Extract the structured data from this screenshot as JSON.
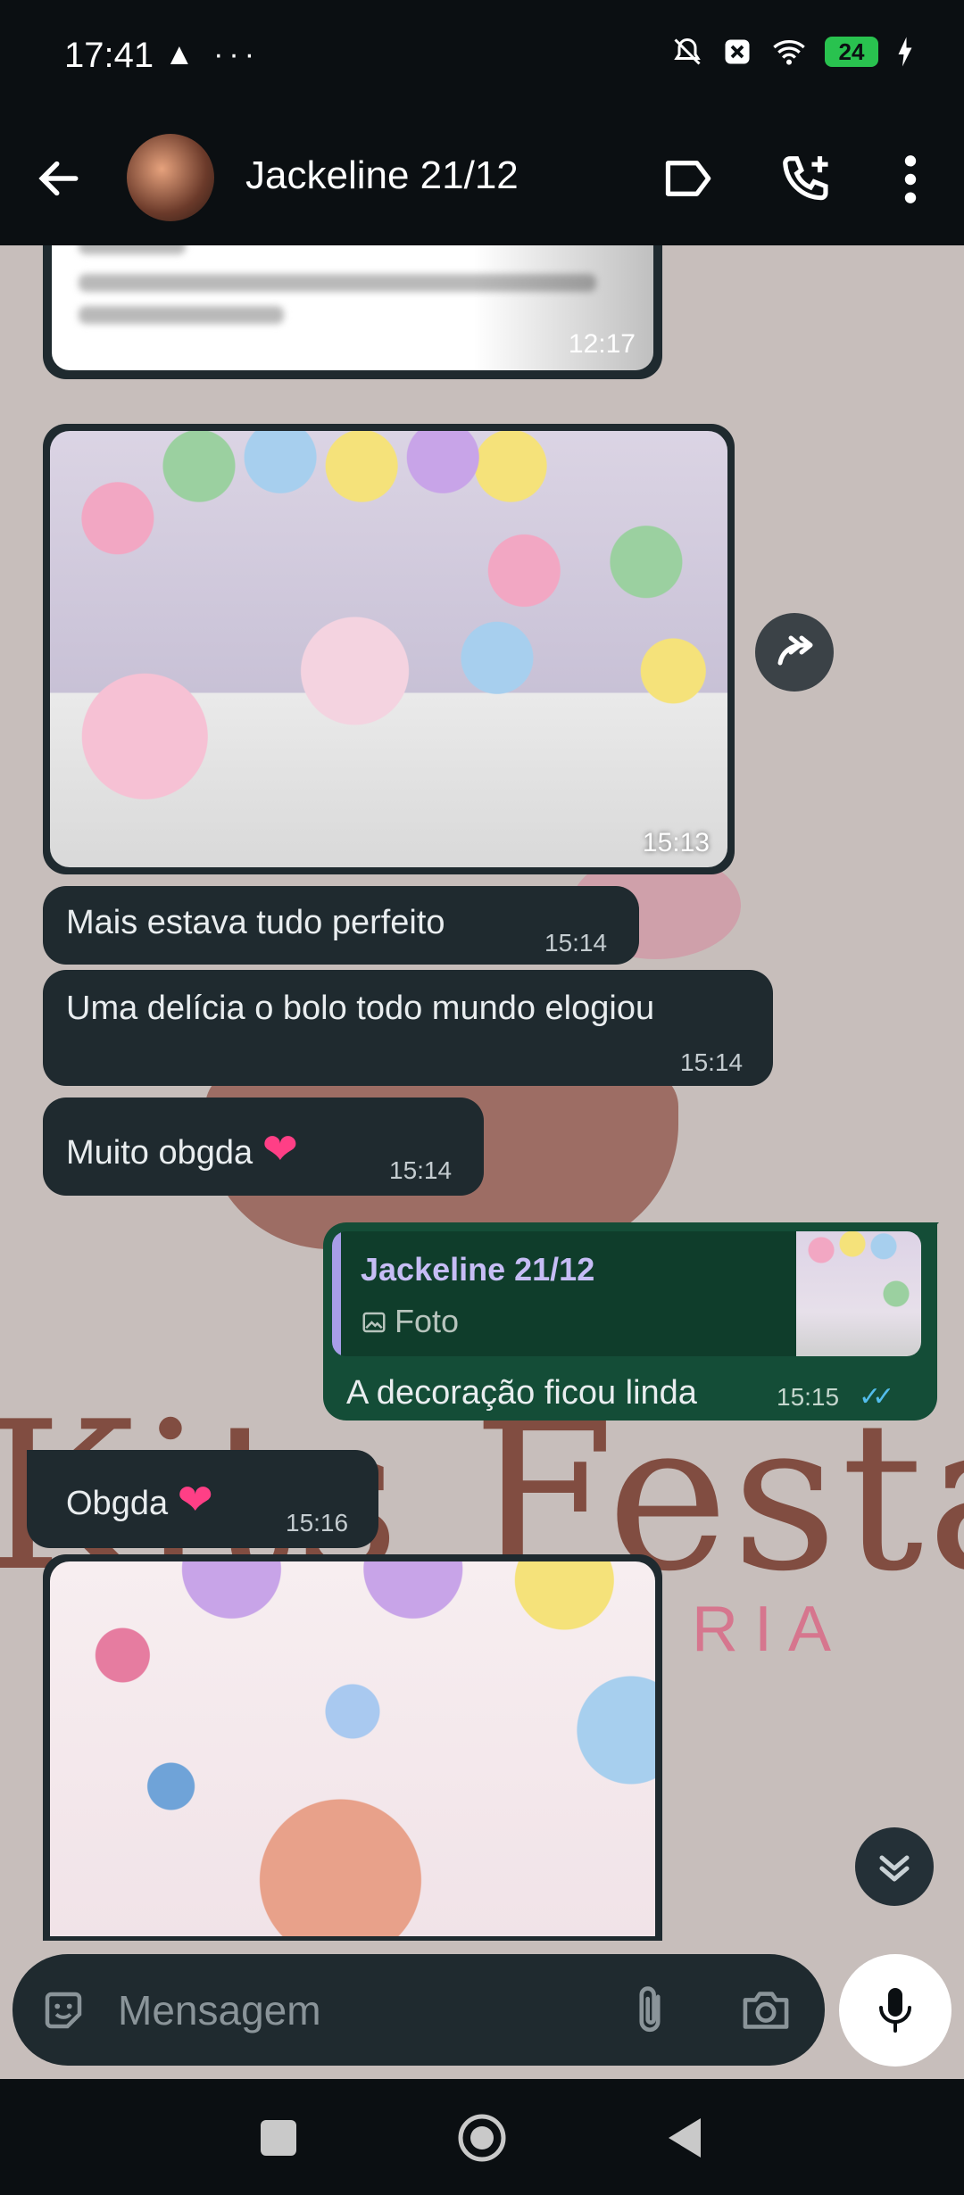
{
  "status": {
    "time": "17:41",
    "left_icons": "▲ ···",
    "battery": "24"
  },
  "header": {
    "contact_name": "Jackeline 21/12"
  },
  "messages": [
    {
      "kind": "document",
      "time": "12:17"
    },
    {
      "kind": "image",
      "time": "15:13"
    },
    {
      "kind": "text",
      "text": "Mais estava tudo perfeito",
      "time": "15:14"
    },
    {
      "kind": "text",
      "text": "Uma delícia o bolo todo mundo elogiou",
      "time": "15:14"
    },
    {
      "kind": "text",
      "text": "Muito obgda",
      "emoji": "❤",
      "time": "15:14"
    },
    {
      "kind": "reply",
      "quoted_name": "Jackeline 21/12",
      "quoted_type": "Foto",
      "text": "A decoração ficou linda",
      "time": "15:15",
      "read": true
    },
    {
      "kind": "text",
      "text": "Obgda",
      "emoji": "❤",
      "time": "15:16"
    },
    {
      "kind": "image"
    }
  ],
  "wallpaper": {
    "title": "Kits Festa",
    "subtitle": "RIA"
  },
  "composer": {
    "placeholder": "Mensagem"
  },
  "colors": {
    "incoming_bubble": "#1f2a2f",
    "outgoing_bubble": "#144d37",
    "read_ticks": "#53bdeb",
    "heart": "#ff3f86"
  }
}
